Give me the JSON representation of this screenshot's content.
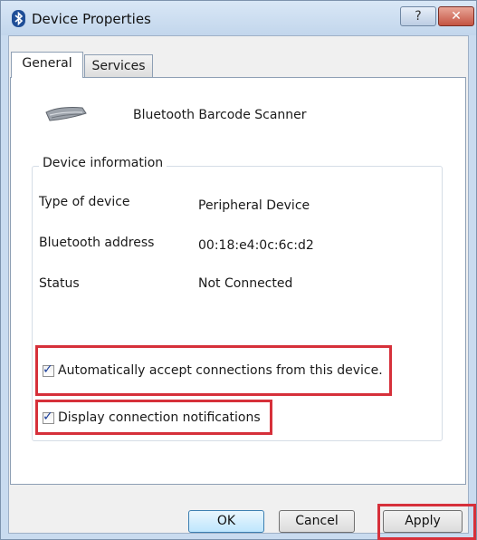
{
  "window": {
    "title": "Device Properties",
    "help_label": "?",
    "close_label": "✕"
  },
  "tabs": [
    {
      "label": "General",
      "selected": true
    },
    {
      "label": "Services",
      "selected": false
    }
  ],
  "device": {
    "icon": "keyboard-scanner-icon",
    "name": "Bluetooth Barcode Scanner"
  },
  "device_info": {
    "legend": "Device information",
    "rows": [
      {
        "label": "Type of device",
        "value": "Peripheral Device"
      },
      {
        "label": "Bluetooth address",
        "value": "00:18:e4:0c:6c:d2"
      },
      {
        "label": "Status",
        "value": "Not Connected"
      }
    ]
  },
  "options": [
    {
      "label": "Automatically accept connections from this device.",
      "checked": true
    },
    {
      "label": "Display connection notifications",
      "checked": true
    }
  ],
  "buttons": {
    "ok": "OK",
    "cancel": "Cancel",
    "apply": "Apply"
  },
  "colors": {
    "highlight": "#d6303a",
    "title_bar": "#c9dbef"
  }
}
